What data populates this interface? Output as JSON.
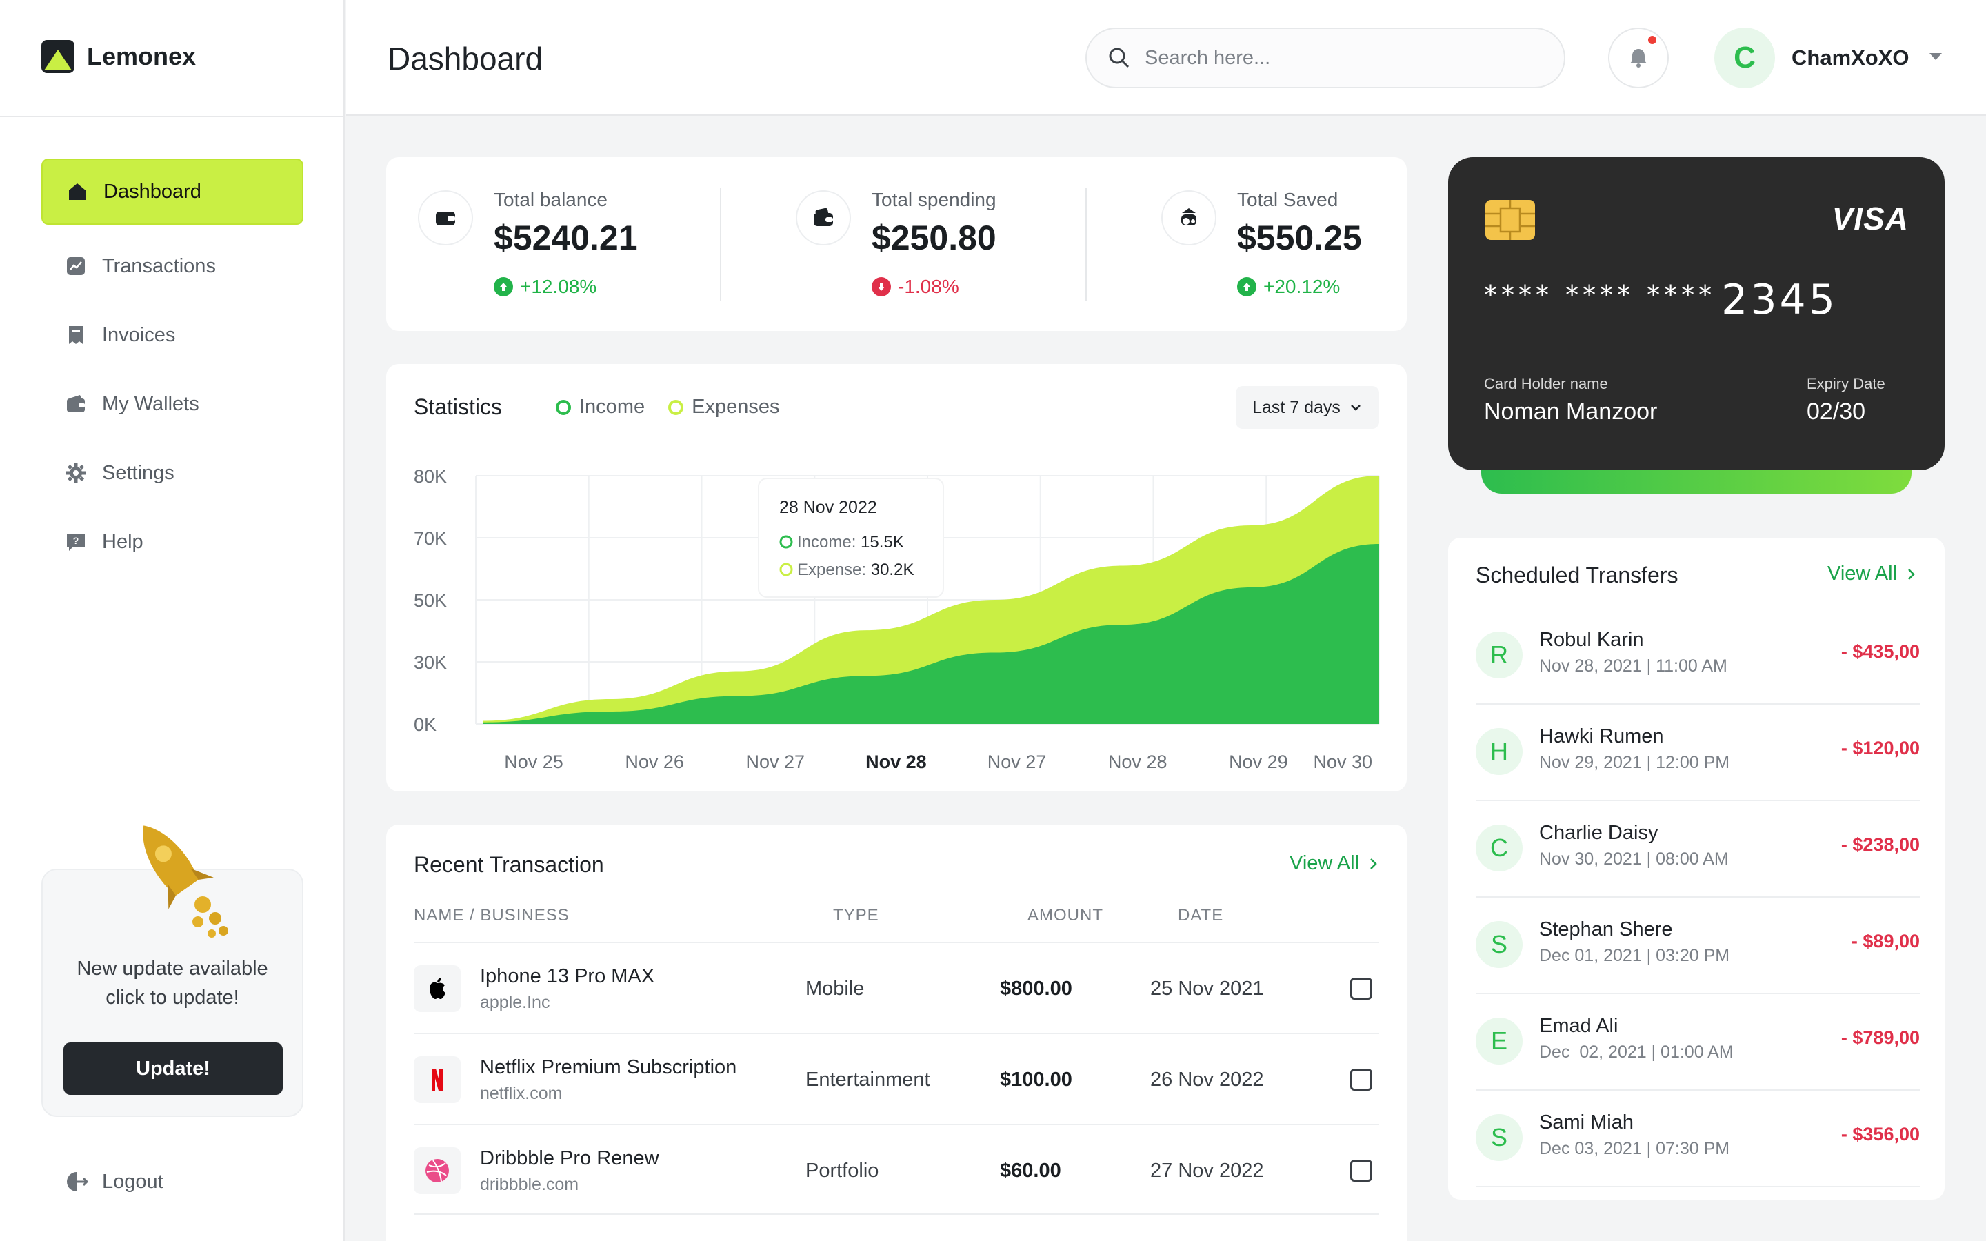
{
  "app": {
    "name": "Lemonex"
  },
  "sidebar": {
    "items": [
      {
        "label": "Dashboard",
        "icon": "home-icon",
        "active": true
      },
      {
        "label": "Transactions",
        "icon": "chart-icon"
      },
      {
        "label": "Invoices",
        "icon": "invoice-icon"
      },
      {
        "label": "My Wallets",
        "icon": "wallet-icon"
      },
      {
        "label": "Settings",
        "icon": "gear-icon"
      },
      {
        "label": "Help",
        "icon": "help-icon"
      }
    ],
    "update_card": {
      "text": "New update available\nclick to update!",
      "button": "Update!"
    },
    "logout_label": "Logout"
  },
  "header": {
    "title": "Dashboard",
    "search_placeholder": "Search here...",
    "user": {
      "initial": "C",
      "name": "ChamXoXO"
    }
  },
  "stats": [
    {
      "label": "Total balance",
      "value": "$5240.21",
      "change": "+12.08%",
      "direction": "up",
      "icon": "wallet-icon"
    },
    {
      "label": "Total spending",
      "value": "$250.80",
      "change": "-1.08%",
      "direction": "down",
      "icon": "wallet-cards-icon"
    },
    {
      "label": "Total Saved",
      "value": "$550.25",
      "change": "+20.12%",
      "direction": "up",
      "icon": "piggy-bank-icon"
    }
  ],
  "statistics": {
    "title": "Statistics",
    "range": "Last 7 days",
    "tooltip": {
      "date": "28 Nov 2022",
      "income_label": "Income:",
      "income_value": "15.5K",
      "expense_label": "Expense:",
      "expense_value": "30.2K"
    }
  },
  "chart_data": {
    "type": "area",
    "categories": [
      "Nov 25",
      "Nov 26",
      "Nov 27",
      "Nov 28",
      "Nov 27",
      "Nov 28",
      "Nov 29",
      "Nov 30"
    ],
    "highlight_category_index": 3,
    "y_tick_labels": [
      "80K",
      "70K",
      "50K",
      "30K",
      "0K"
    ],
    "ylim": [
      0,
      80000
    ],
    "grid": true,
    "legend_position": "top",
    "series": [
      {
        "name": "Income",
        "color": "#2dbd4e",
        "values": [
          500,
          4000,
          9000,
          15500,
          23000,
          32000,
          44000,
          58000
        ]
      },
      {
        "name": "Expenses",
        "color": "#c9ef44",
        "values": [
          1000,
          8000,
          17000,
          30200,
          40000,
          51000,
          64000,
          80000
        ]
      }
    ]
  },
  "recent": {
    "title": "Recent Transaction",
    "view_all": "View All",
    "columns": [
      "NAME / BUSINESS",
      "TYPE",
      "AMOUNT",
      "DATE"
    ],
    "rows": [
      {
        "name": "Iphone 13 Pro MAX",
        "sub": "apple.Inc",
        "type": "Mobile",
        "amount": "$800.00",
        "date": "25 Nov 2021",
        "logo": "apple-icon"
      },
      {
        "name": "Netflix Premium Subscription",
        "sub": "netflix.com",
        "type": "Entertainment",
        "amount": "$100.00",
        "date": "26 Nov 2022",
        "logo": "netflix-icon"
      },
      {
        "name": "Dribbble Pro Renew",
        "sub": "dribbble.com",
        "type": "Portfolio",
        "amount": "$60.00",
        "date": "27 Nov 2022",
        "logo": "dribbble-icon"
      }
    ]
  },
  "card": {
    "brand": "VISA",
    "masked": "**** **** ****",
    "last4": "2345",
    "holder_label": "Card Holder name",
    "holder_name": "Noman Manzoor",
    "expiry_label": "Expiry Date",
    "expiry": "02/30"
  },
  "transfers": {
    "title": "Scheduled Transfers",
    "view_all": "View All",
    "items": [
      {
        "initial": "R",
        "name": "Robul Karin",
        "date": "Nov 28, 2021 | 11:00 AM",
        "amount": "- $435,00"
      },
      {
        "initial": "H",
        "name": "Hawki Rumen",
        "date": "Nov 29, 2021 | 12:00 PM",
        "amount": "- $120,00"
      },
      {
        "initial": "C",
        "name": "Charlie Daisy",
        "date": "Nov 30, 2021 | 08:00 AM",
        "amount": "- $238,00"
      },
      {
        "initial": "S",
        "name": "Stephan Shere",
        "date": "Dec 01, 2021 | 03:20 PM",
        "amount": "- $89,00"
      },
      {
        "initial": "E",
        "name": "Emad Ali",
        "date": "Dec  02, 2021 | 01:00 AM",
        "amount": "- $789,00"
      },
      {
        "initial": "S",
        "name": "Sami Miah",
        "date": "Dec 03, 2021 | 07:30 PM",
        "amount": "- $356,00"
      }
    ]
  },
  "colors": {
    "accent": "#c9ef44",
    "green": "#2dbd4e",
    "red": "#e0304a",
    "dark": "#25292e"
  }
}
